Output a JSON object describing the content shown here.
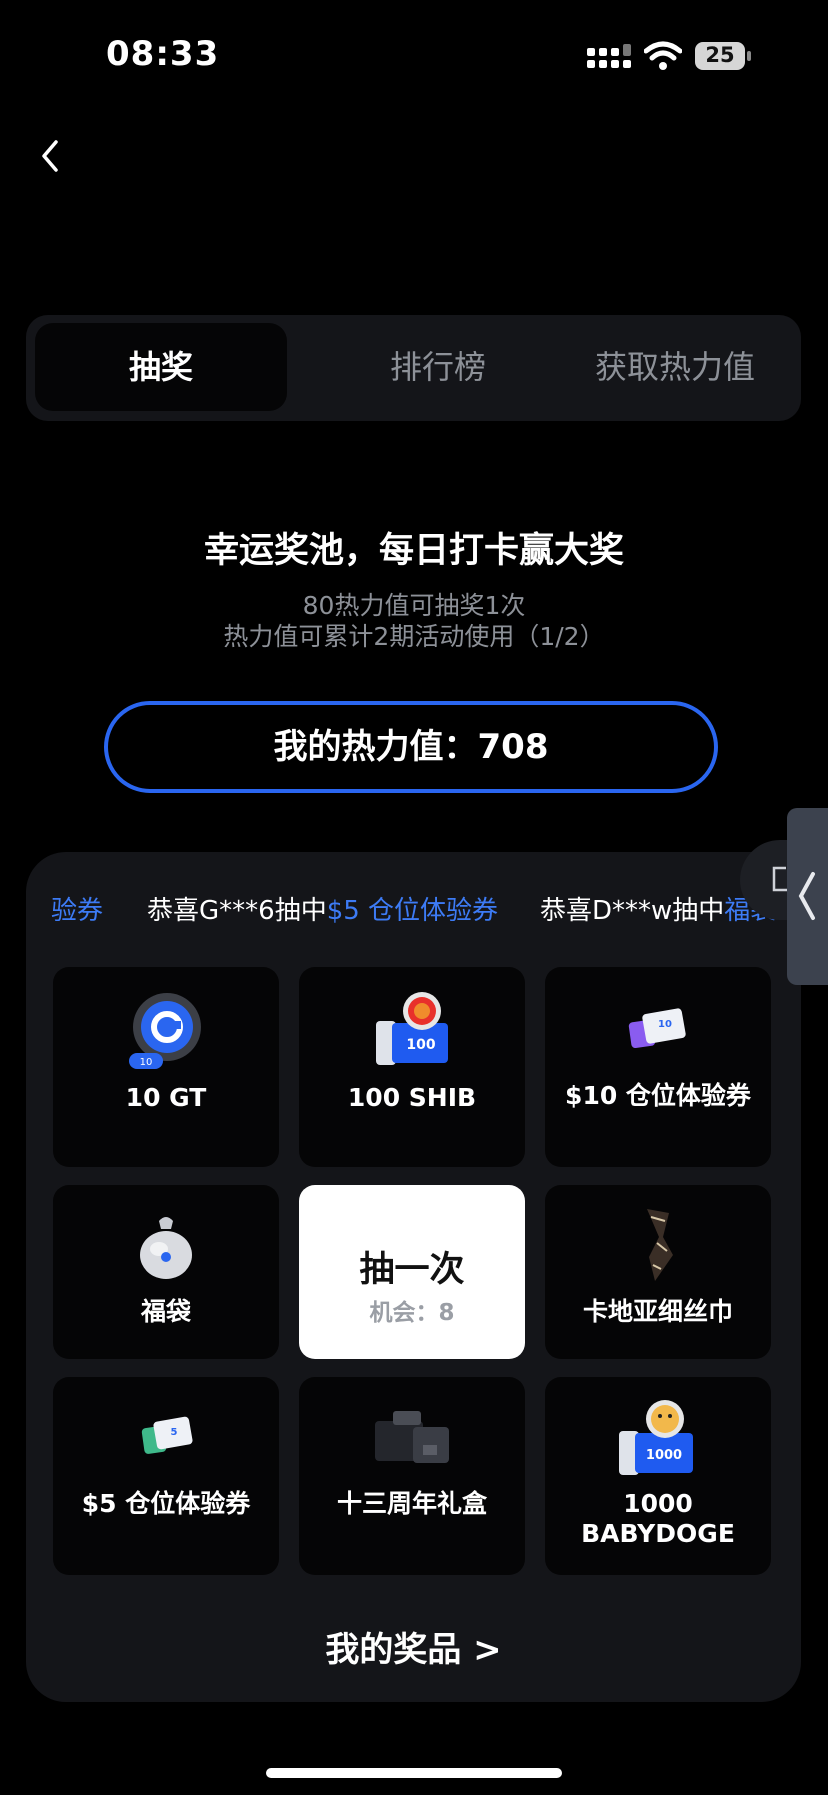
{
  "status_bar": {
    "time": "08:33",
    "battery": "25"
  },
  "tabs": [
    {
      "label": "抽奖",
      "active": true
    },
    {
      "label": "排行榜",
      "active": false
    },
    {
      "label": "获取热力值",
      "active": false
    }
  ],
  "headline": "幸运奖池，每日打卡赢大奖",
  "sub_lines": [
    "80热力值可抽奖1次",
    "热力值可累计2期活动使用（1/2）"
  ],
  "heat_value": "我的热力值：708",
  "marquee": [
    {
      "prefix": "",
      "prize": "验券"
    },
    {
      "prefix": "恭喜G***6抽中",
      "prize": "$5 仓位体验券"
    },
    {
      "prefix": "恭喜D***w抽中",
      "prize": "福袋"
    }
  ],
  "prizes": [
    {
      "label": "10 GT",
      "icon": "gt-coin-icon",
      "badge": "10"
    },
    {
      "label": "100 SHIB",
      "icon": "shib-token-icon",
      "badge": "100"
    },
    {
      "label": "$10 仓位体验券",
      "icon": "voucher-10-icon",
      "badge": "10"
    },
    {
      "label": "福袋",
      "icon": "lucky-bag-icon"
    },
    {
      "label": "卡地亚细丝巾",
      "icon": "silk-scarf-icon"
    },
    {
      "label": "$5 仓位体验券",
      "icon": "voucher-5-icon",
      "badge": "5"
    },
    {
      "label": "十三周年礼盒",
      "icon": "gift-box-icon"
    },
    {
      "label": "1000 BABYDOGE",
      "icon": "babydoge-token-icon",
      "badge": "1000"
    }
  ],
  "draw": {
    "label": "抽一次",
    "chances": "机会：8"
  },
  "my_prizes": "我的奖品 >",
  "colors": {
    "accent": "#2a66f0",
    "link": "#3d7bf5",
    "panel": "#141519",
    "cell": "#050506"
  }
}
